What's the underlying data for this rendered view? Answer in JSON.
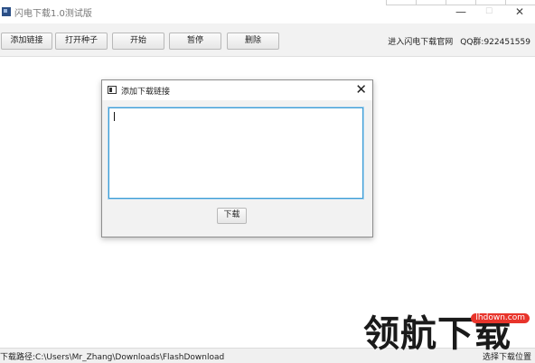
{
  "window": {
    "title": "闪电下载1.0测试版",
    "controls": {
      "minimize": "—",
      "maximize": "☐",
      "close": "✕"
    }
  },
  "toolbar": {
    "buttons": [
      "添加链接",
      "打开种子",
      "开始",
      "暂停",
      "删除"
    ],
    "website_link": "进入闪电下载官网",
    "qq_group": "QQ群:922451559"
  },
  "dialog": {
    "title": "添加下载链接",
    "close": "✕",
    "url_input_value": "",
    "download_button": "下载"
  },
  "statusbar": {
    "path": "下载路径:C:\\Users\\Mr_Zhang\\Downloads\\FlashDownload",
    "choose_location": "选择下载位置"
  },
  "watermark": {
    "text": "领航下载",
    "url": "lhdown.com",
    "color": "#e8342b"
  }
}
